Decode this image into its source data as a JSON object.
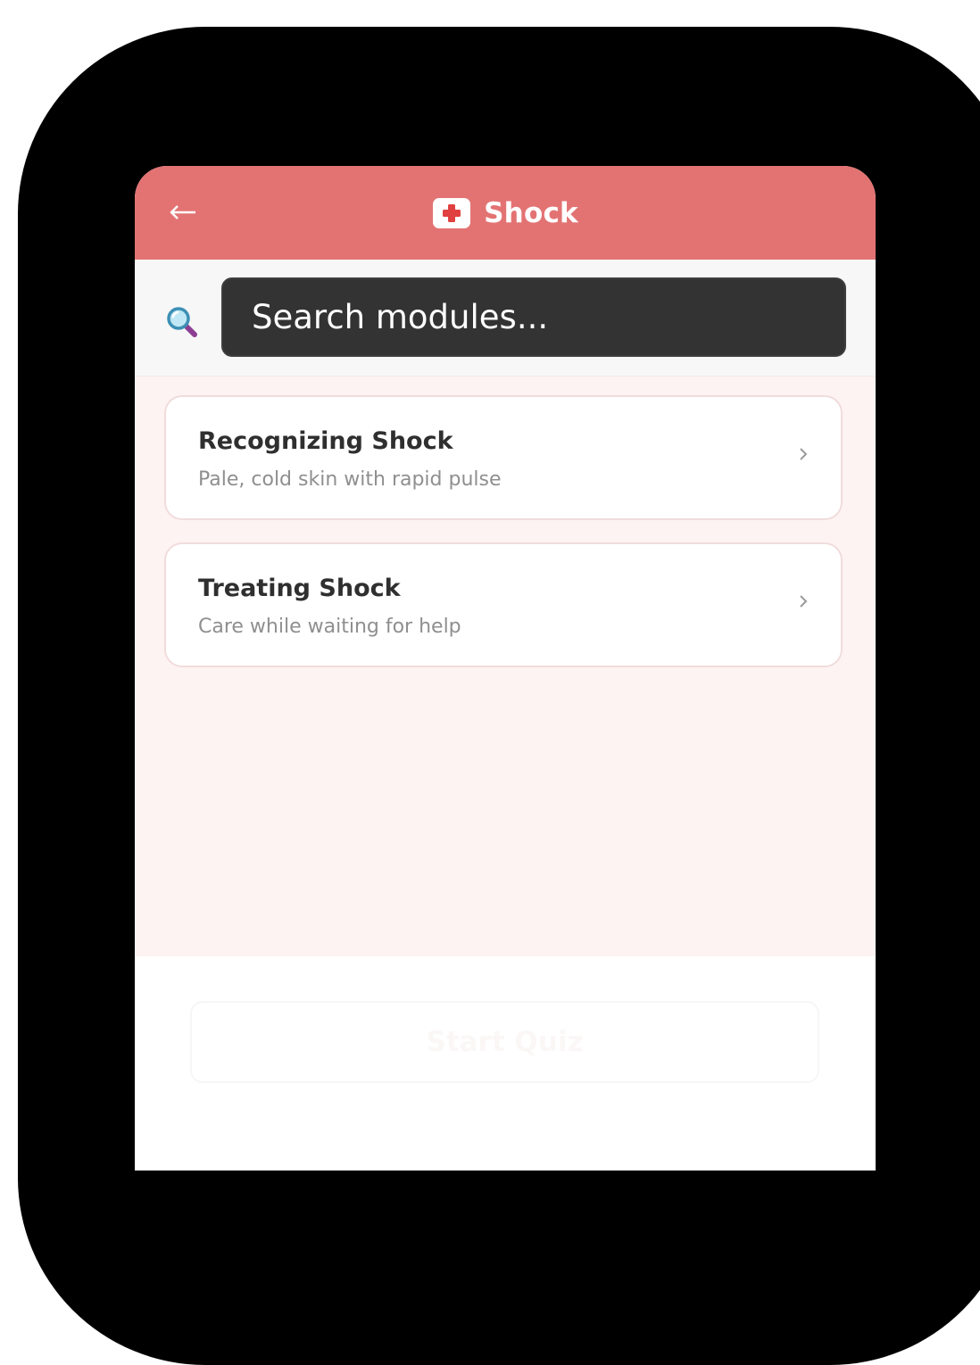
{
  "header": {
    "back_glyph": "←",
    "title": "Shock",
    "icon": "first-aid-icon",
    "background_color": "#e37373"
  },
  "search": {
    "placeholder": "Search modules...",
    "icon": "magnifying-glass-icon"
  },
  "modules": [
    {
      "title": "Recognizing Shock",
      "subtitle": "Pale, cold skin with rapid pulse",
      "icon": "chevron-right-icon"
    },
    {
      "title": "Treating Shock",
      "subtitle": "Care while waiting for help",
      "icon": "chevron-right-icon"
    }
  ],
  "footer": {
    "start_label": "Start Quiz"
  },
  "colors": {
    "accent": "#e37373",
    "list_background": "#fdf3f2",
    "search_field": "#333333"
  }
}
